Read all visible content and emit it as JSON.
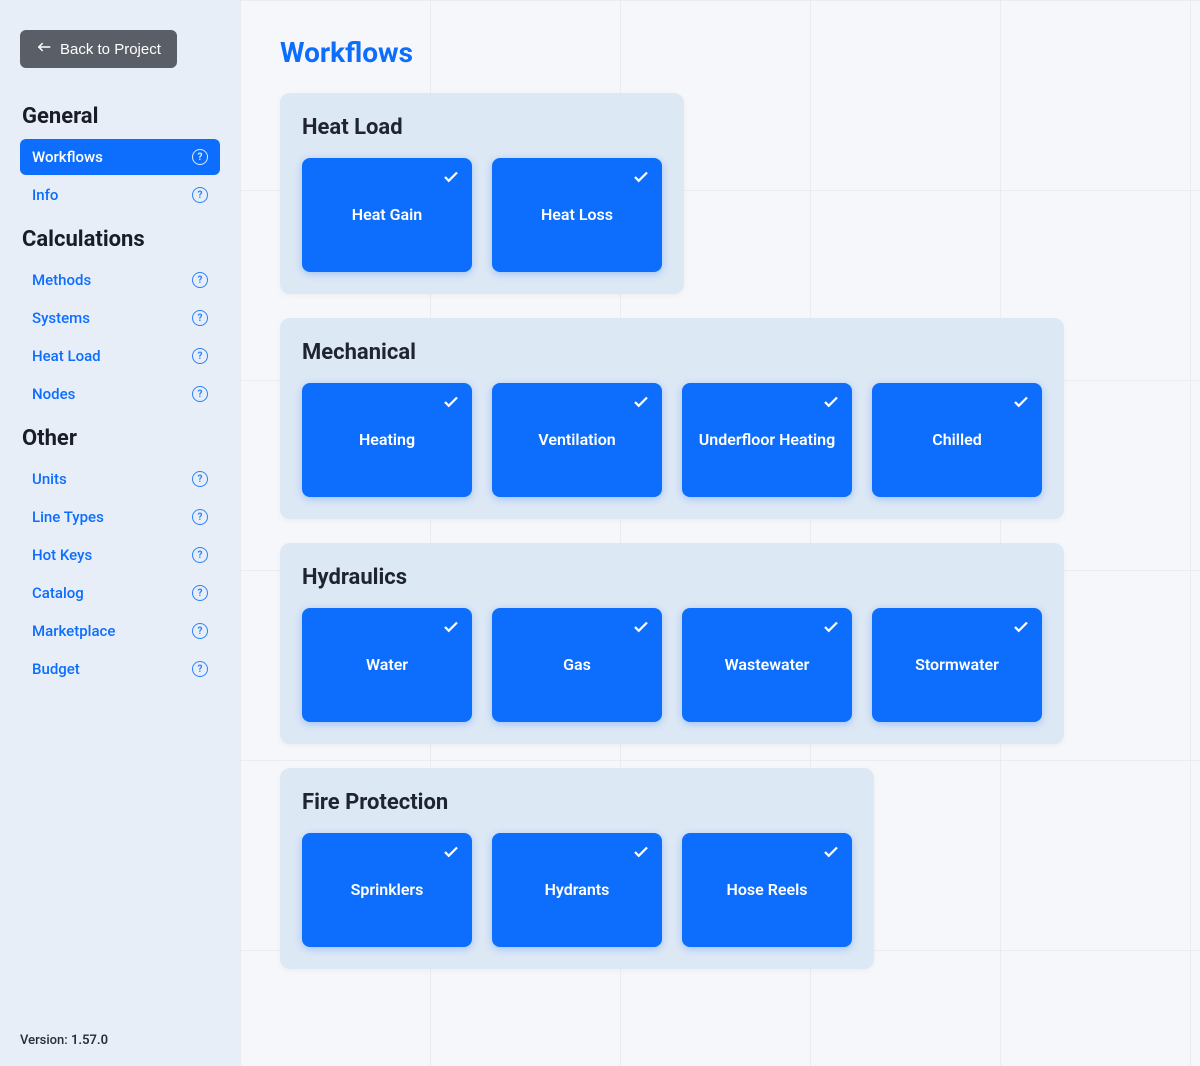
{
  "sidebar": {
    "back_label": "Back to Project",
    "groups": [
      {
        "title": "General",
        "items": [
          {
            "label": "Workflows",
            "active": true
          },
          {
            "label": "Info",
            "active": false
          }
        ]
      },
      {
        "title": "Calculations",
        "items": [
          {
            "label": "Methods",
            "active": false
          },
          {
            "label": "Systems",
            "active": false
          },
          {
            "label": "Heat Load",
            "active": false
          },
          {
            "label": "Nodes",
            "active": false
          }
        ]
      },
      {
        "title": "Other",
        "items": [
          {
            "label": "Units",
            "active": false
          },
          {
            "label": "Line Types",
            "active": false
          },
          {
            "label": "Hot Keys",
            "active": false
          },
          {
            "label": "Catalog",
            "active": false
          },
          {
            "label": "Marketplace",
            "active": false
          },
          {
            "label": "Budget",
            "active": false
          }
        ]
      }
    ],
    "version_label": "Version:",
    "version": "1.57.0"
  },
  "main": {
    "title": "Workflows",
    "groups": [
      {
        "title": "Heat Load",
        "cards": [
          {
            "label": "Heat Gain",
            "checked": true
          },
          {
            "label": "Heat Loss",
            "checked": true
          }
        ]
      },
      {
        "title": "Mechanical",
        "cards": [
          {
            "label": "Heating",
            "checked": true
          },
          {
            "label": "Ventilation",
            "checked": true
          },
          {
            "label": "Underfloor Heating",
            "checked": true
          },
          {
            "label": "Chilled",
            "checked": true
          }
        ]
      },
      {
        "title": "Hydraulics",
        "cards": [
          {
            "label": "Water",
            "checked": true
          },
          {
            "label": "Gas",
            "checked": true
          },
          {
            "label": "Wastewater",
            "checked": true
          },
          {
            "label": "Stormwater",
            "checked": true
          }
        ]
      },
      {
        "title": "Fire Protection",
        "cards": [
          {
            "label": "Sprinklers",
            "checked": true
          },
          {
            "label": "Hydrants",
            "checked": true
          },
          {
            "label": "Hose Reels",
            "checked": true
          }
        ]
      }
    ]
  }
}
